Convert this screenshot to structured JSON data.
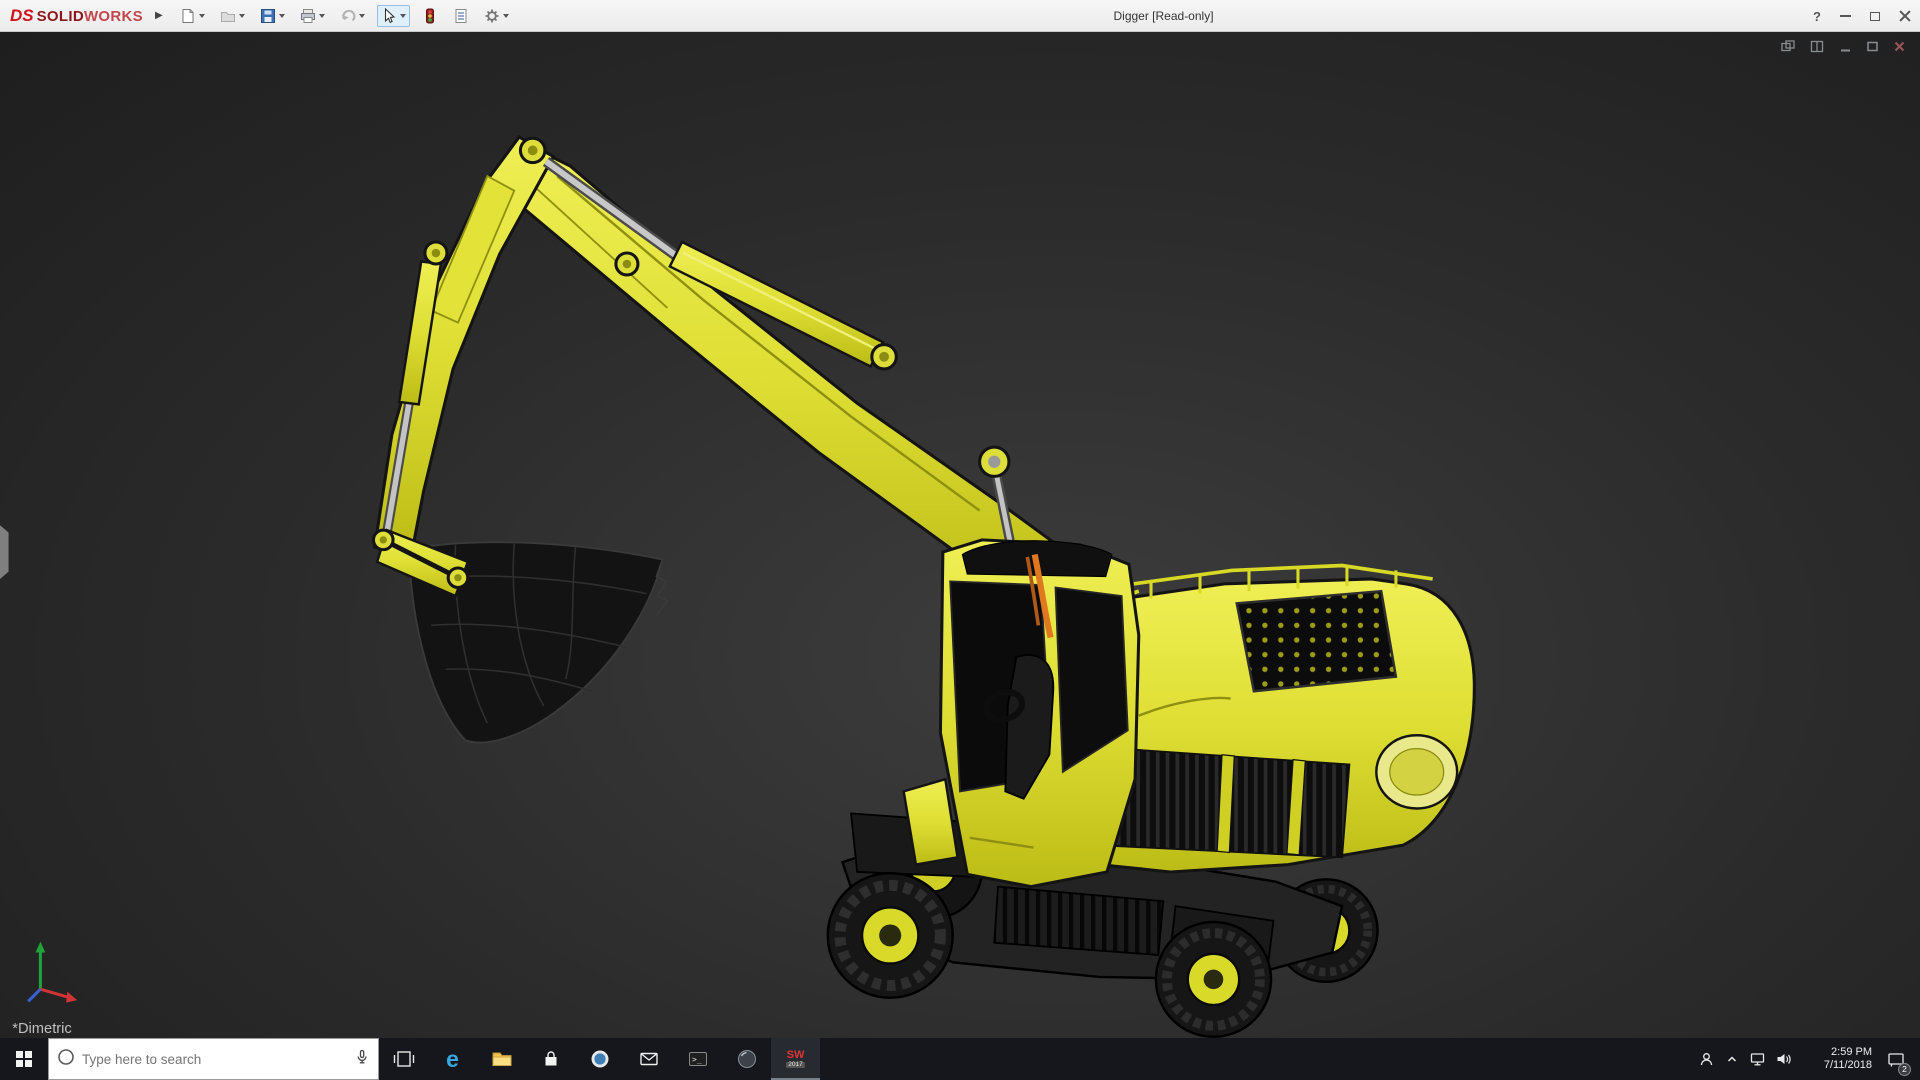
{
  "app": {
    "logo": {
      "mark": "DS",
      "brand_bold": "SOLID",
      "brand_light": "WORKS"
    },
    "flyout_arrow": "▶",
    "title": "Digger [Read-only]",
    "help_glyph": "?"
  },
  "toolbar": {
    "items": [
      "new-document",
      "open",
      "save",
      "print",
      "undo",
      "select",
      "rebuild",
      "file-properties",
      "options"
    ],
    "active_tool": "select"
  },
  "viewport": {
    "view_label": "*Dimetric",
    "model_name": "Digger",
    "doc_window_controls": [
      "new-window",
      "cascade",
      "minimize",
      "restore",
      "close"
    ],
    "background": "#2b2b2b",
    "model_accent_color": "#d8d422"
  },
  "taskbar": {
    "search_placeholder": "Type here to search",
    "app_icons": [
      "task-view",
      "edge",
      "file-explorer",
      "store",
      "circle-app",
      "mail",
      "command-prompt",
      "sphere-app",
      "solidworks-2017"
    ],
    "edge_glyph": "e",
    "prompt_glyph": ">_",
    "solidworks_icon": {
      "letters": "SW",
      "year": "2017"
    },
    "tray": {
      "time": "2:59 PM",
      "date": "7/11/2018",
      "notification_count": "2"
    }
  },
  "colors": {
    "titlebar_bg": "#f0f0f0",
    "taskbar_bg": "#15171c",
    "brand_red": "#8d181c",
    "excavator_yellow": "#d8d422"
  }
}
